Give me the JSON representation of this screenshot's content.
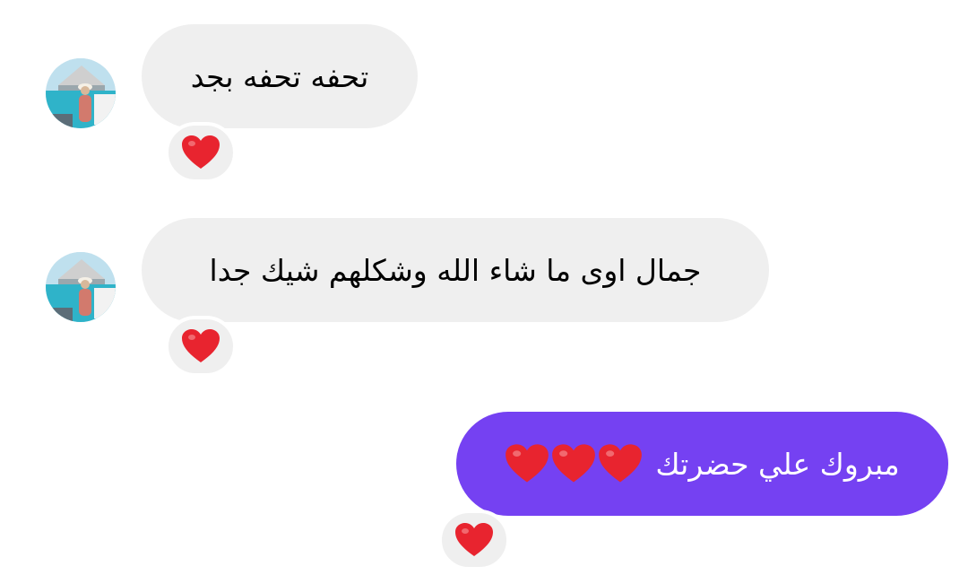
{
  "theme": {
    "incoming_bubble_color": "#efefef",
    "outgoing_bubble_color": "#7541f2",
    "heart_color": "#e8242f",
    "reaction_bg": "#efefef"
  },
  "messages": [
    {
      "direction": "incoming",
      "text": "تحفه تحفه بجد",
      "avatar_icon": "profile-photo-avatar",
      "reaction": "❤️"
    },
    {
      "direction": "incoming",
      "text": "جمال اوى ما شاء الله وشكلهم شيك جدا",
      "avatar_icon": "profile-photo-avatar",
      "reaction": "❤️"
    },
    {
      "direction": "outgoing",
      "text": "مبروك علي حضرتك",
      "emoji_suffix": "❤️❤️❤️",
      "reaction": "❤️"
    }
  ]
}
